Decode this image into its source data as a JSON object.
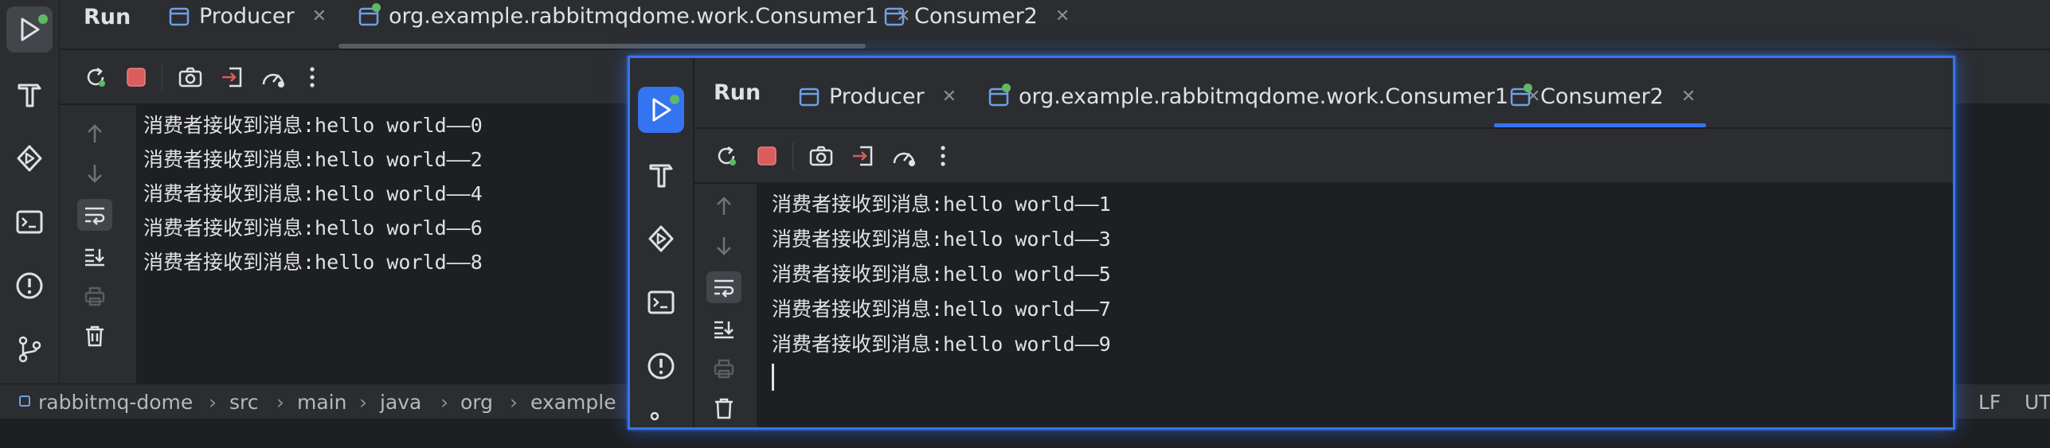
{
  "colors": {
    "bg": "#1e1f22",
    "panel": "#2b2d30",
    "accent": "#3574f0",
    "text": "#dfe1e5",
    "stop": "#db5c5c",
    "run_green": "#5fb865"
  },
  "main": {
    "tool_title": "Run",
    "tabs": [
      {
        "label": "Producer",
        "icon": "run-config-icon"
      },
      {
        "label": "org.example.rabbitmqdome.work.Consumer1",
        "icon": "run-config-icon"
      },
      {
        "label": "Consumer2",
        "icon": "run-config-icon"
      }
    ],
    "output": [
      "消费者接收到消息:hello world——0",
      "消费者接收到消息:hello world——2",
      "消费者接收到消息:hello world——4",
      "消费者接收到消息:hello world——6",
      "消费者接收到消息:hello world——8"
    ]
  },
  "floating": {
    "tool_title": "Run",
    "tabs": [
      {
        "label": "Producer",
        "icon": "run-config-icon"
      },
      {
        "label": "org.example.rabbitmqdome.work.Consumer1",
        "icon": "run-config-icon"
      },
      {
        "label": "Consumer2",
        "icon": "run-config-icon",
        "selected": true
      }
    ],
    "output": [
      "消费者接收到消息:hello world——1",
      "消费者接收到消息:hello world——3",
      "消费者接收到消息:hello world——5",
      "消费者接收到消息:hello world——7",
      "消费者接收到消息:hello world——9"
    ]
  },
  "statusbar": {
    "breadcrumb": [
      "rabbitmq-dome",
      "src",
      "main",
      "java",
      "org",
      "example"
    ],
    "line_separator": "LF",
    "encoding": "UT"
  },
  "icons": {
    "rail": [
      "run-icon",
      "build-hammer-icon",
      "services-icon",
      "terminal-icon",
      "problems-icon",
      "git-branch-icon"
    ],
    "toolbar": [
      "rerun-icon",
      "stop-icon",
      "screenshot-icon",
      "exit-icon",
      "profiler-icon",
      "more-icon"
    ],
    "gutter": [
      "scroll-up-icon",
      "scroll-down-icon",
      "soft-wrap-icon",
      "scroll-to-end-icon",
      "print-icon",
      "trash-icon"
    ]
  }
}
